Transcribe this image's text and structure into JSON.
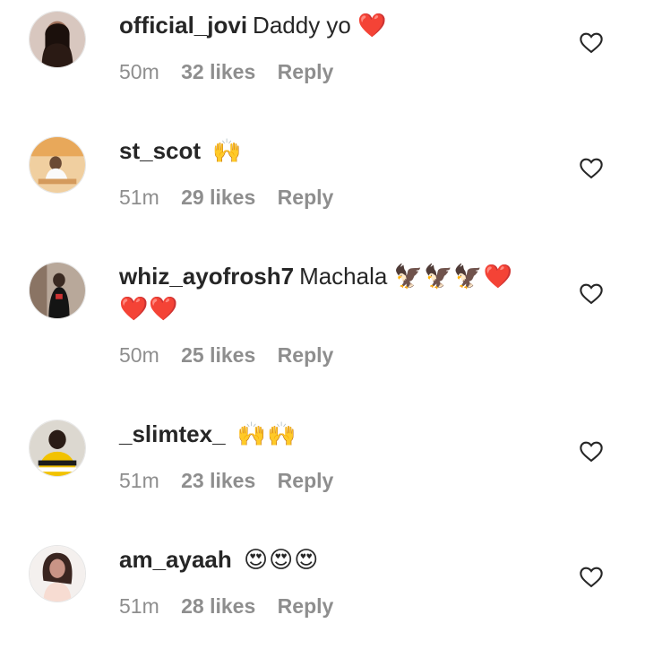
{
  "comments": [
    {
      "username": "official_jovi",
      "text": "Daddy yo",
      "emojis": "❤️",
      "time": "50m",
      "likes": "32 likes",
      "reply": "Reply",
      "avatar_color": "#3b2a24"
    },
    {
      "username": "st_scot",
      "text": "",
      "emojis": "🙌",
      "time": "51m",
      "likes": "29 likes",
      "reply": "Reply",
      "avatar_color": "#e9b06a"
    },
    {
      "username": "whiz_ayofrosh7",
      "text": "Machala",
      "emojis": "🦅🦅🦅❤️ ❤️❤️",
      "time": "50m",
      "likes": "25 likes",
      "reply": "Reply",
      "avatar_color": "#6d5a50"
    },
    {
      "username": "_slimtex_",
      "text": "",
      "emojis": "🙌🙌",
      "time": "51m",
      "likes": "23 likes",
      "reply": "Reply",
      "avatar_color": "#2d3545"
    },
    {
      "username": "am_ayaah",
      "text": "",
      "emojis": "😍😍😍",
      "time": "51m",
      "likes": "28 likes",
      "reply": "Reply",
      "avatar_color": "#c9a79a"
    }
  ],
  "icons": {
    "like": "heart-outline-icon"
  }
}
